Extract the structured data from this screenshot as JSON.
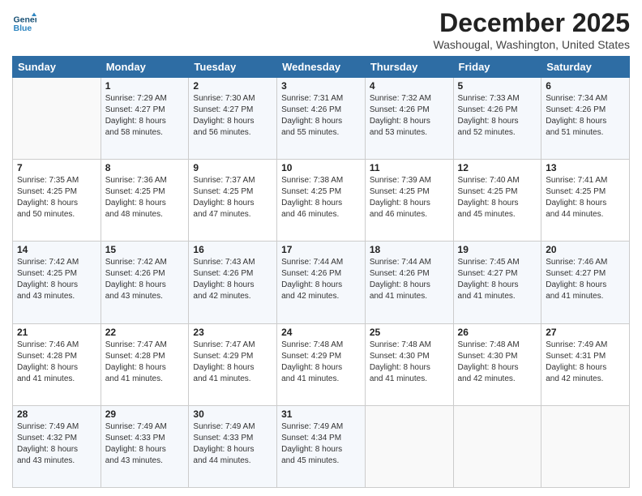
{
  "logo": {
    "line1": "General",
    "line2": "Blue"
  },
  "title": "December 2025",
  "location": "Washougal, Washington, United States",
  "days_of_week": [
    "Sunday",
    "Monday",
    "Tuesday",
    "Wednesday",
    "Thursday",
    "Friday",
    "Saturday"
  ],
  "weeks": [
    [
      {
        "day": "",
        "info": ""
      },
      {
        "day": "1",
        "info": "Sunrise: 7:29 AM\nSunset: 4:27 PM\nDaylight: 8 hours\nand 58 minutes."
      },
      {
        "day": "2",
        "info": "Sunrise: 7:30 AM\nSunset: 4:27 PM\nDaylight: 8 hours\nand 56 minutes."
      },
      {
        "day": "3",
        "info": "Sunrise: 7:31 AM\nSunset: 4:26 PM\nDaylight: 8 hours\nand 55 minutes."
      },
      {
        "day": "4",
        "info": "Sunrise: 7:32 AM\nSunset: 4:26 PM\nDaylight: 8 hours\nand 53 minutes."
      },
      {
        "day": "5",
        "info": "Sunrise: 7:33 AM\nSunset: 4:26 PM\nDaylight: 8 hours\nand 52 minutes."
      },
      {
        "day": "6",
        "info": "Sunrise: 7:34 AM\nSunset: 4:26 PM\nDaylight: 8 hours\nand 51 minutes."
      }
    ],
    [
      {
        "day": "7",
        "info": "Sunrise: 7:35 AM\nSunset: 4:25 PM\nDaylight: 8 hours\nand 50 minutes."
      },
      {
        "day": "8",
        "info": "Sunrise: 7:36 AM\nSunset: 4:25 PM\nDaylight: 8 hours\nand 48 minutes."
      },
      {
        "day": "9",
        "info": "Sunrise: 7:37 AM\nSunset: 4:25 PM\nDaylight: 8 hours\nand 47 minutes."
      },
      {
        "day": "10",
        "info": "Sunrise: 7:38 AM\nSunset: 4:25 PM\nDaylight: 8 hours\nand 46 minutes."
      },
      {
        "day": "11",
        "info": "Sunrise: 7:39 AM\nSunset: 4:25 PM\nDaylight: 8 hours\nand 46 minutes."
      },
      {
        "day": "12",
        "info": "Sunrise: 7:40 AM\nSunset: 4:25 PM\nDaylight: 8 hours\nand 45 minutes."
      },
      {
        "day": "13",
        "info": "Sunrise: 7:41 AM\nSunset: 4:25 PM\nDaylight: 8 hours\nand 44 minutes."
      }
    ],
    [
      {
        "day": "14",
        "info": "Sunrise: 7:42 AM\nSunset: 4:25 PM\nDaylight: 8 hours\nand 43 minutes."
      },
      {
        "day": "15",
        "info": "Sunrise: 7:42 AM\nSunset: 4:26 PM\nDaylight: 8 hours\nand 43 minutes."
      },
      {
        "day": "16",
        "info": "Sunrise: 7:43 AM\nSunset: 4:26 PM\nDaylight: 8 hours\nand 42 minutes."
      },
      {
        "day": "17",
        "info": "Sunrise: 7:44 AM\nSunset: 4:26 PM\nDaylight: 8 hours\nand 42 minutes."
      },
      {
        "day": "18",
        "info": "Sunrise: 7:44 AM\nSunset: 4:26 PM\nDaylight: 8 hours\nand 41 minutes."
      },
      {
        "day": "19",
        "info": "Sunrise: 7:45 AM\nSunset: 4:27 PM\nDaylight: 8 hours\nand 41 minutes."
      },
      {
        "day": "20",
        "info": "Sunrise: 7:46 AM\nSunset: 4:27 PM\nDaylight: 8 hours\nand 41 minutes."
      }
    ],
    [
      {
        "day": "21",
        "info": "Sunrise: 7:46 AM\nSunset: 4:28 PM\nDaylight: 8 hours\nand 41 minutes."
      },
      {
        "day": "22",
        "info": "Sunrise: 7:47 AM\nSunset: 4:28 PM\nDaylight: 8 hours\nand 41 minutes."
      },
      {
        "day": "23",
        "info": "Sunrise: 7:47 AM\nSunset: 4:29 PM\nDaylight: 8 hours\nand 41 minutes."
      },
      {
        "day": "24",
        "info": "Sunrise: 7:48 AM\nSunset: 4:29 PM\nDaylight: 8 hours\nand 41 minutes."
      },
      {
        "day": "25",
        "info": "Sunrise: 7:48 AM\nSunset: 4:30 PM\nDaylight: 8 hours\nand 41 minutes."
      },
      {
        "day": "26",
        "info": "Sunrise: 7:48 AM\nSunset: 4:30 PM\nDaylight: 8 hours\nand 42 minutes."
      },
      {
        "day": "27",
        "info": "Sunrise: 7:49 AM\nSunset: 4:31 PM\nDaylight: 8 hours\nand 42 minutes."
      }
    ],
    [
      {
        "day": "28",
        "info": "Sunrise: 7:49 AM\nSunset: 4:32 PM\nDaylight: 8 hours\nand 43 minutes."
      },
      {
        "day": "29",
        "info": "Sunrise: 7:49 AM\nSunset: 4:33 PM\nDaylight: 8 hours\nand 43 minutes."
      },
      {
        "day": "30",
        "info": "Sunrise: 7:49 AM\nSunset: 4:33 PM\nDaylight: 8 hours\nand 44 minutes."
      },
      {
        "day": "31",
        "info": "Sunrise: 7:49 AM\nSunset: 4:34 PM\nDaylight: 8 hours\nand 45 minutes."
      },
      {
        "day": "",
        "info": ""
      },
      {
        "day": "",
        "info": ""
      },
      {
        "day": "",
        "info": ""
      }
    ]
  ]
}
